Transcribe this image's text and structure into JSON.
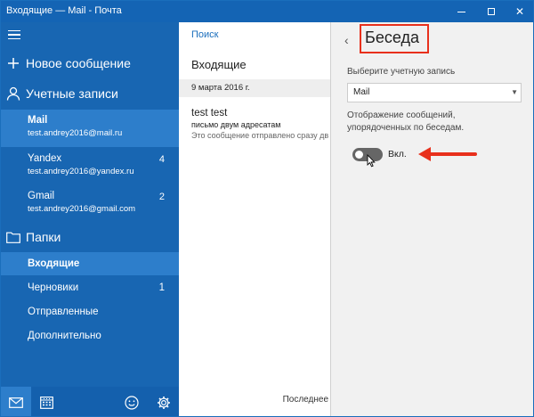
{
  "window": {
    "title": "Входящие — Mail - Почта"
  },
  "nav": {
    "new_message": "Новое сообщение",
    "accounts_header": "Учетные записи",
    "accounts": [
      {
        "name": "Mail",
        "email": "test.andrey2016@mail.ru",
        "count": ""
      },
      {
        "name": "Yandex",
        "email": "test.andrey2016@yandex.ru",
        "count": "4"
      },
      {
        "name": "Gmail",
        "email": "test.andrey2016@gmail.com",
        "count": "2"
      }
    ],
    "folders_header": "Папки",
    "folders": [
      {
        "label": "Входящие",
        "count": ""
      },
      {
        "label": "Черновики",
        "count": "1"
      },
      {
        "label": "Отправленные",
        "count": ""
      },
      {
        "label": "Дополнительно",
        "count": ""
      }
    ]
  },
  "list": {
    "search_label": "Поиск",
    "title": "Входящие",
    "date_header": "9 марта 2016 г.",
    "message": {
      "from": "test test",
      "subject": "письмо двум адресатам",
      "preview": "Это сообщение отправлено сразу дв"
    },
    "footer": "Последнее"
  },
  "settings": {
    "title": "Беседа",
    "account_label": "Выберите учетную запись",
    "account_value": "Mail",
    "conversation_label_line1": "Отображение сообщений,",
    "conversation_label_line2": "упорядоченных по беседам.",
    "toggle_state": "Вкл.",
    "toggle_on": true
  },
  "colors": {
    "nav_bg": "#1866b2",
    "nav_selected": "#2d7ecb",
    "titlebar": "#1464b4",
    "highlight_red": "#e8301c",
    "link_blue": "#1a6ebc"
  }
}
